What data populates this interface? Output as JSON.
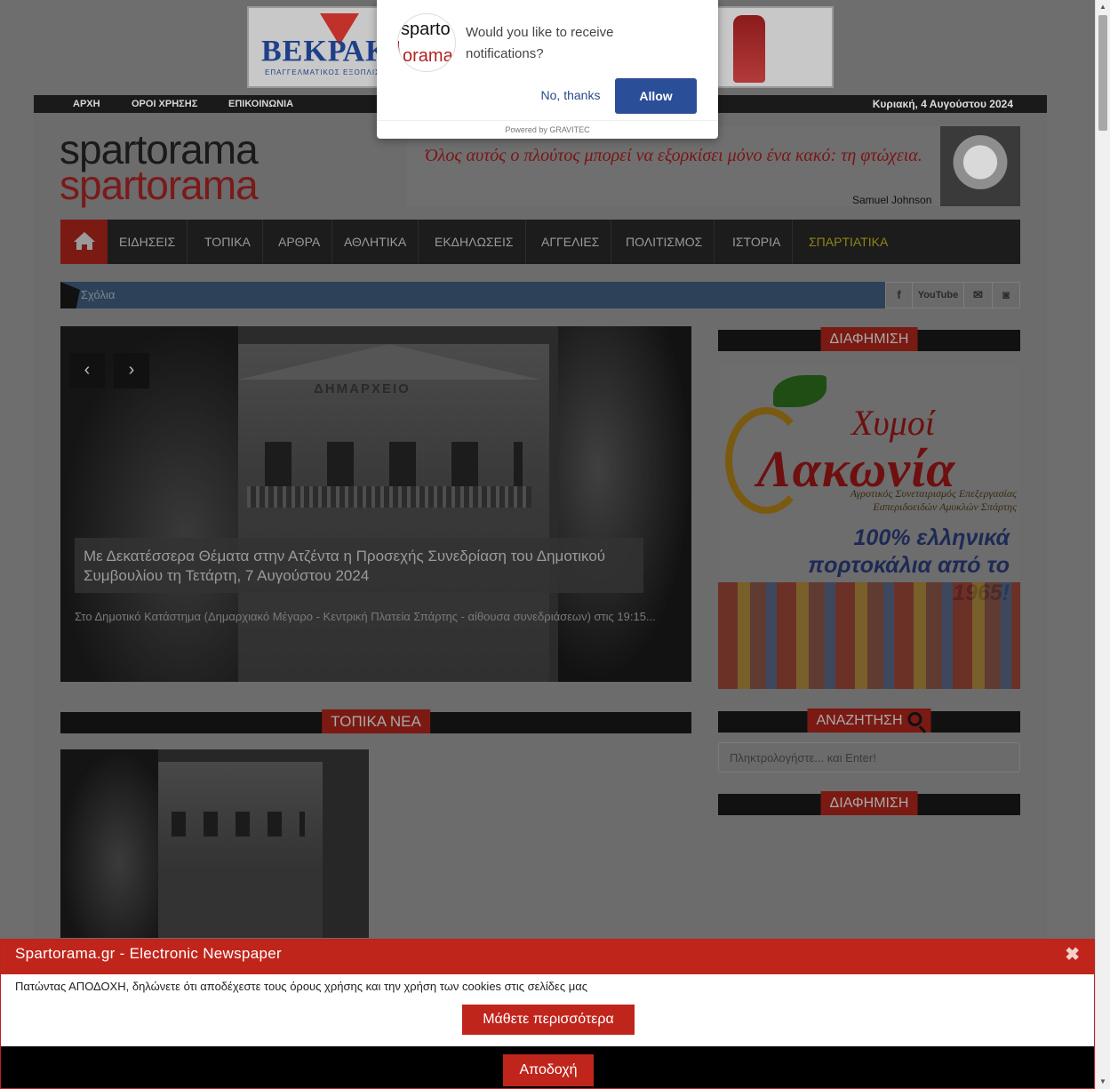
{
  "banner": {
    "brand": "ΒΕΚΡΑΚΟΣ",
    "subtitle": "ΕΠΑΓΓΕΛΜΑΤΙΚΟΣ ΕΞΟΠΛΙΣΜΟΣ"
  },
  "topnav": {
    "items": [
      "ΑΡΧΗ",
      "ΟΡΟΙ ΧΡΗΣΗΣ",
      "ΕΠΙΚΟΙΝΩΝΙΑ"
    ],
    "date": "Κυριακή, 4 Αυγούστου 2024"
  },
  "logo": {
    "line1": "spartorama",
    "line2": "spartorama"
  },
  "quote": {
    "text": "Όλος αυτός ο πλούτος μπορεί να εξορκίσει μόνο ένα κακό: τη φτώχεια.",
    "author": "Samuel Johnson"
  },
  "menu": {
    "home_icon": "home-icon",
    "items": [
      "ΕΙΔΗΣΕΙΣ",
      "ΤΟΠΙΚΑ",
      "ΑΡΘΡΑ",
      "ΑΘΛΗΤΙΚΑ",
      "ΕΚΔΗΛΩΣΕΙΣ",
      "ΑΓΓΕΛΙΕΣ",
      "ΠΟΛΙΤΙΣΜΟΣ",
      "ΙΣΤΟΡΙΑ",
      "ΣΠΑΡΤΙΑΤΙΚΑ"
    ]
  },
  "ticker": {
    "label": "Σχόλια"
  },
  "social": {
    "facebook": "f",
    "youtube": "YouTube",
    "email": "✉",
    "rss": "◙"
  },
  "slider": {
    "prev": "‹",
    "next": "›",
    "building_sign": "ΔΗΜΑΡΧΕΙΟ",
    "title": "Με Δεκατέσσερα Θέματα στην Ατζέντα η Προσεχής Συνεδρίαση του Δημοτικού Συμβουλίου τη Τετάρτη, 7 Αυγούστου 2024",
    "excerpt": "Στο Δημοτικό Κατάστημα (Δημαρχιακό Μέγαρο - Κεντρική Πλατεία Σπάρτης - αίθουσα συνεδριάσεων) στις 19:15..."
  },
  "sidebar": {
    "ad_heading": "ΔΙΑΦΗΜΙΣΗ",
    "ad": {
      "brand_line1": "Χυμοί",
      "brand_line2": "Λακωνία",
      "sub": "Αγροτικός Συνεταιρισμός Επεξεργασίας Εσπεριδοειδών Αμυκλών Σπάρτης",
      "slogan": "100% ελληνικά πορτοκάλια από το 1965!"
    },
    "search_heading": "ΑΝΑΖΗΤΗΣΗ",
    "search_placeholder": "Πληκτρολογήστε... και Enter!",
    "ad_heading2": "ΔΙΑΦΗΜΙΣΗ"
  },
  "local_news": {
    "heading": "ΤΟΠΙΚΑ ΝΕΑ"
  },
  "notification": {
    "logo_line1": "sparto",
    "logo_line2": "orama",
    "message": "Would you like to receive notifications?",
    "no_label": "No, thanks",
    "allow_label": "Allow",
    "powered": "Powered by GRAVITEC"
  },
  "cookie": {
    "title": "Spartorama.gr - Electronic Newspaper",
    "close": "✖",
    "message": "Πατώντας ΑΠΟΔΟΧΗ, δηλώνετε ότι αποδέχεστε τους όρους χρήσης και την χρήση των cookies στις σελίδες μας",
    "more_label": "Μάθετε περισσότερα",
    "accept_label": "Αποδοχή"
  }
}
